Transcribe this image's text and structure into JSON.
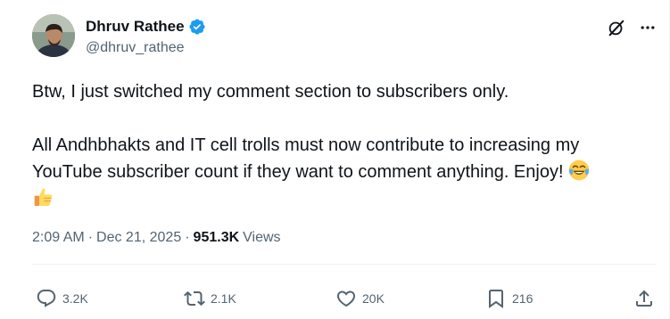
{
  "author": {
    "display_name": "Dhruv Rathee",
    "handle": "@dhruv_rathee",
    "verified": true
  },
  "tweet": {
    "paragraph1": "Btw, I just switched my comment section to subscribers only.",
    "paragraph2": "All Andhbhakts and IT cell trolls must now contribute to increasing my YouTube subscriber count if they want to comment anything. Enjoy!",
    "emojis": [
      "face-with-tears-of-joy",
      "thumbs-up"
    ]
  },
  "meta": {
    "time": "2:09 AM",
    "separator": "·",
    "date": "Dec 21, 2025",
    "views_count": "951.3K",
    "views_label": "Views"
  },
  "engagement": {
    "replies": "3.2K",
    "reposts": "2.1K",
    "likes": "20K",
    "bookmarks": "216"
  },
  "icons": {
    "reply": "reply-icon",
    "repost": "repost-icon",
    "like": "heart-icon",
    "bookmark": "bookmark-icon",
    "share": "share-icon",
    "grok": "grok-icon",
    "more": "more-icon",
    "verified": "verified-badge-icon"
  },
  "colors": {
    "text_primary": "#0f1419",
    "text_secondary": "#536471",
    "verified_blue": "#1d9bf0",
    "divider": "#eff3f4"
  }
}
